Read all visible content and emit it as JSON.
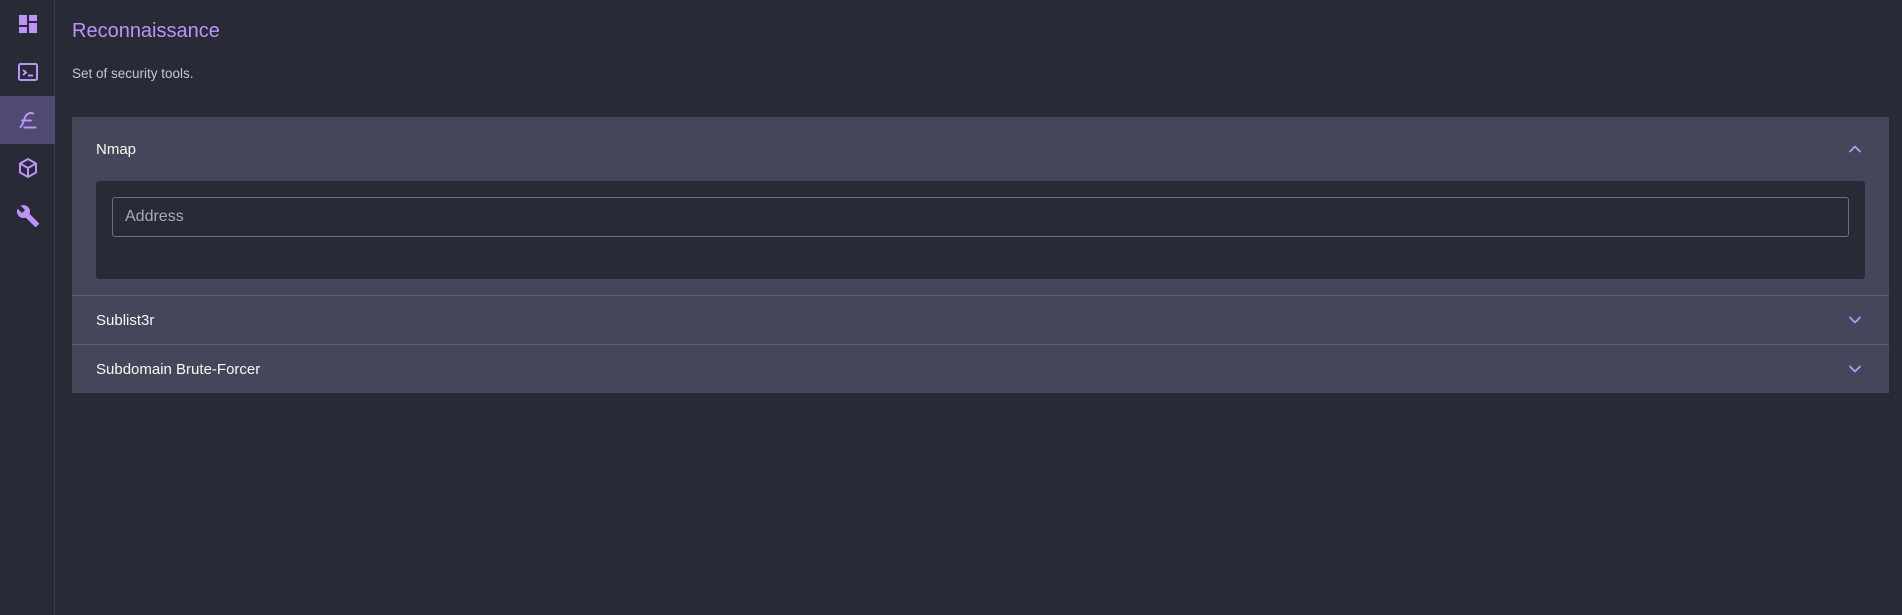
{
  "sidebar": {
    "items": [
      {
        "icon": "dashboard-icon",
        "active": false
      },
      {
        "icon": "terminal-icon",
        "active": false
      },
      {
        "icon": "recon-icon",
        "active": true
      },
      {
        "icon": "package-icon",
        "active": false
      },
      {
        "icon": "wrench-icon",
        "active": false
      }
    ]
  },
  "page": {
    "title": "Reconnaissance",
    "subtitle": "Set of security tools."
  },
  "tools": [
    {
      "name": "Nmap",
      "expanded": true,
      "input_placeholder": "Address"
    },
    {
      "name": "Sublist3r",
      "expanded": false
    },
    {
      "name": "Subdomain Brute-Forcer",
      "expanded": false
    }
  ],
  "colors": {
    "background": "#282a36",
    "panel": "#44475a",
    "accent": "#bd93f9",
    "active_nav": "#4e4a72",
    "text": "#f8f8f2"
  }
}
